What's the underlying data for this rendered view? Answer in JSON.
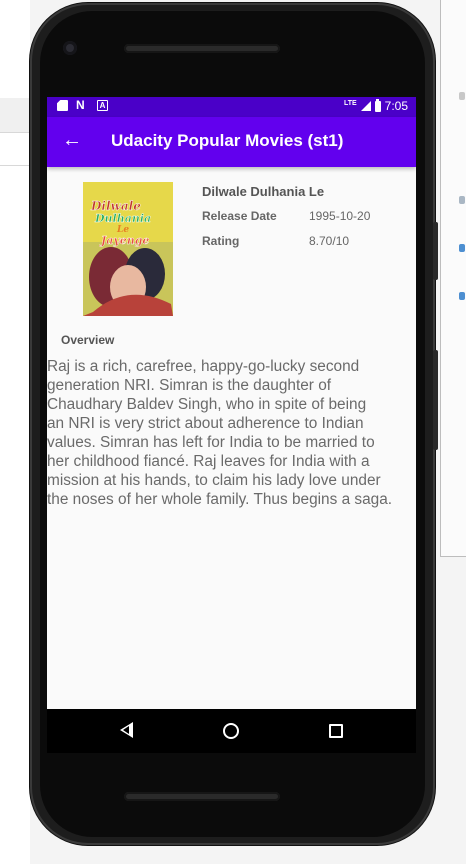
{
  "statusbar": {
    "time": "7:05",
    "network": "LTE",
    "left_icons": [
      "sd-card-icon",
      "n-notification-icon",
      "a-notification-icon"
    ]
  },
  "appbar": {
    "title": "Udacity Popular Movies (st1)",
    "back_icon": "arrow-left-icon",
    "color": "#6200ee",
    "status_color": "#4a00c8"
  },
  "movie": {
    "title": "Dilwale Dulhania Le",
    "release_label": "Release Date",
    "release_value": "1995-10-20",
    "rating_label": "Rating",
    "rating_value": "8.70/10",
    "poster_text": "Dilwale Dulhania Le Jayenge",
    "overview_label": "Overview",
    "overview": "Raj is a rich, carefree, happy-go-lucky second\ngeneration NRI. Simran is the daughter of\nChaudhary Baldev Singh, who in spite of being\nan NRI is very strict about adherence to Indian\nvalues. Simran has left for India to be married to\nher childhood fiancé. Raj leaves for India with a\nmission at his hands, to claim his lady love under\nthe noses of her whole family. Thus begins a saga."
  },
  "navbar": {
    "icons": [
      "back-triangle-icon",
      "home-circle-icon",
      "recents-square-icon"
    ]
  }
}
